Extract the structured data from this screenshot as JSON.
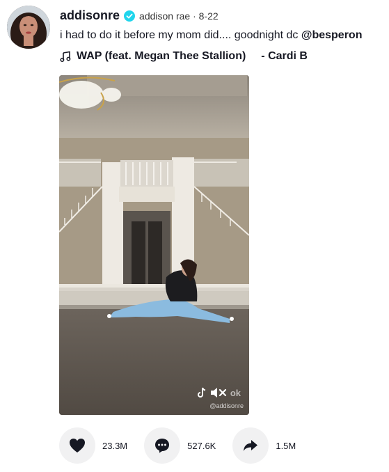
{
  "post": {
    "username": "addisonre",
    "nickname": "addison rae · 8-22",
    "caption_text": "i had to do it before my mom did.... goodnight dc ",
    "mention": "@besperon",
    "music_title": "WAP  (feat. Megan Thee Stallion)",
    "music_artist": "- Cardi B"
  },
  "video": {
    "watermark_user": "@addisonre",
    "watermark_brand": "ok"
  },
  "actions": {
    "likes": "23.3M",
    "comments": "527.6K",
    "shares": "1.5M"
  },
  "colors": {
    "verified": "#20d5ec",
    "text": "#161823",
    "action_bg": "#f1f1f2"
  }
}
